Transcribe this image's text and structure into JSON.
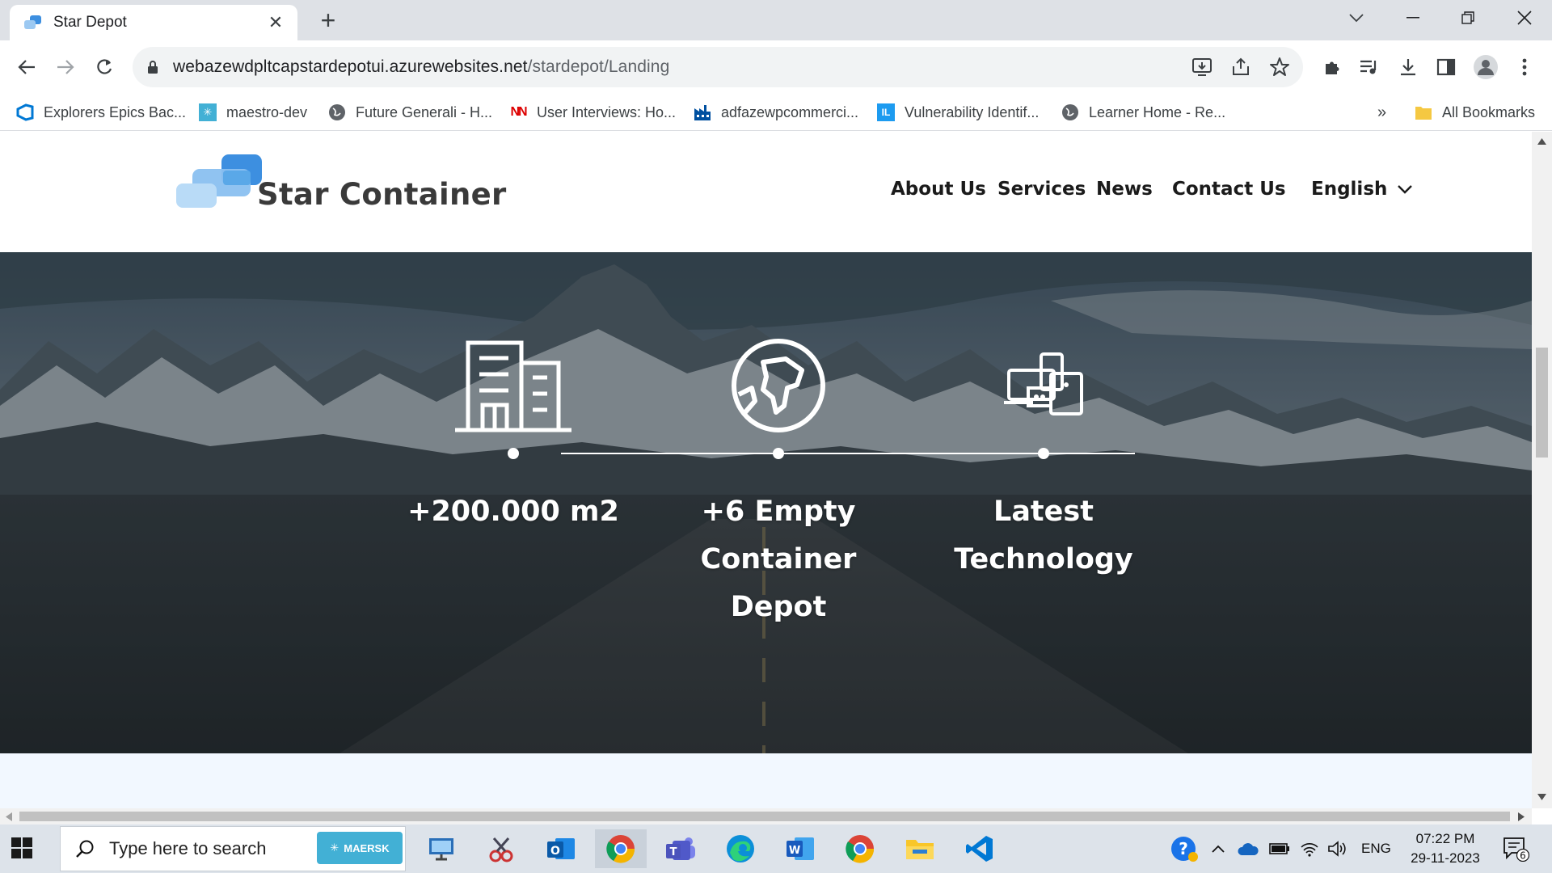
{
  "browser": {
    "tab": {
      "title": "Star Depot",
      "close_glyph": "✕"
    },
    "new_tab_glyph": "+",
    "window_controls": [
      "chevron-down",
      "minimize",
      "restore",
      "close"
    ],
    "address_bar": {
      "host": "webazewdpltcapstardepotui.azurewebsites.net",
      "path": "/stardepot/Landing"
    },
    "bookmarks": [
      {
        "label": "Explorers Epics Bac...",
        "icon": "azure-devops-icon"
      },
      {
        "label": "maestro-dev",
        "icon": "maersk-star-icon"
      },
      {
        "label": "Future Generali - H...",
        "icon": "globe-icon"
      },
      {
        "label": "User Interviews: Ho...",
        "icon": "nn-logo-icon",
        "icon_text": "NN"
      },
      {
        "label": "adfazewpcommerci...",
        "icon": "factory-icon"
      },
      {
        "label": "Vulnerability Identif...",
        "icon": "il-logo-icon",
        "icon_text": "IL"
      },
      {
        "label": "Learner Home - Re...",
        "icon": "globe-icon"
      }
    ],
    "bookmarks_overflow": "»",
    "all_bookmarks": "All Bookmarks"
  },
  "site": {
    "brand": "Star Container",
    "nav": [
      {
        "label": "About Us"
      },
      {
        "label": "Services"
      },
      {
        "label": "News"
      },
      {
        "label": "Contact Us"
      }
    ],
    "language": "English",
    "features": [
      {
        "icon": "building-icon",
        "title": "+200.000 m2"
      },
      {
        "icon": "globe-africa-icon",
        "title": "+6 Empty Container Depot"
      },
      {
        "icon": "devices-icon",
        "title": "Latest Technology"
      }
    ]
  },
  "taskbar": {
    "search_placeholder": "Type here to search",
    "search_badge": "MAERSK",
    "apps": [
      "remote-desktop-icon",
      "snipping-tool-icon",
      "outlook-icon",
      "chrome-icon",
      "teams-icon",
      "edge-icon",
      "word-icon",
      "chrome-icon",
      "file-explorer-icon",
      "vscode-icon"
    ],
    "language_indicator": "ENG",
    "time": "07:22 PM",
    "date": "29-11-2023",
    "notification_count": "6"
  },
  "colors": {
    "brand_blue": "#5aa8e8",
    "tab_strip": "#dee1e6",
    "taskbar": "#dde3ea",
    "maersk": "#42b0d5"
  }
}
